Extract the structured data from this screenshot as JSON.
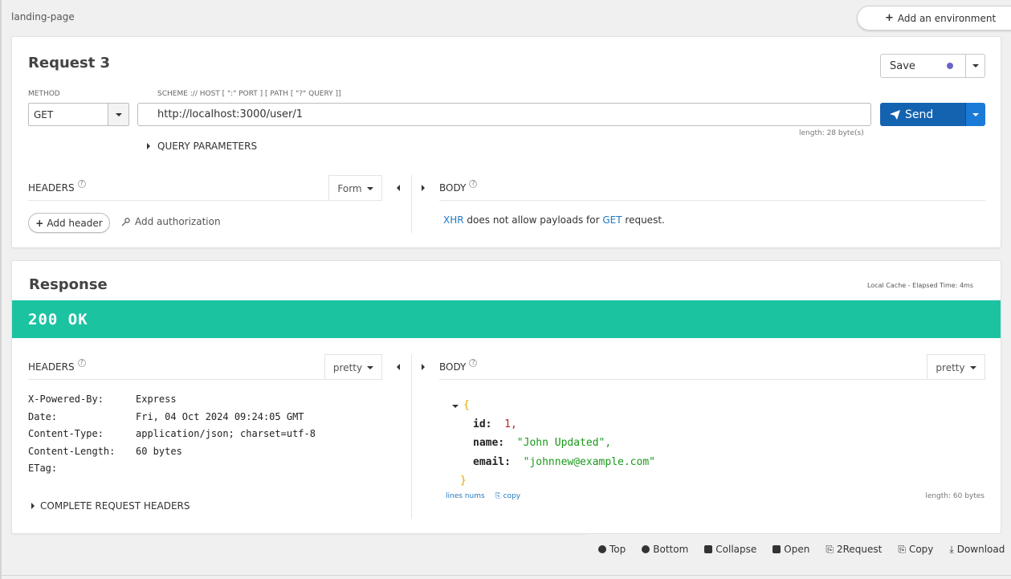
{
  "topbar": {
    "breadcrumb": "landing-page",
    "add_env_label": "Add an environment"
  },
  "request": {
    "title": "Request 3",
    "method_label": "METHOD",
    "url_label": "SCHEME :// HOST [ \":\" PORT ] [ PATH [ \"?\" QUERY ]]",
    "method_value": "GET",
    "url_value": "http://localhost:3000/user/1",
    "url_length": "length: 28 byte(s)",
    "save_label": "Save",
    "send_label": "Send",
    "query_params_label": "QUERY PARAMETERS",
    "headers_label": "HEADERS",
    "headers_mode": "Form",
    "body_label": "BODY",
    "add_header_label": "Add header",
    "add_auth_label": "Add authorization",
    "body_msg_xhr": "XHR",
    "body_msg_mid": " does not allow payloads for ",
    "body_msg_get": "GET",
    "body_msg_end": " request."
  },
  "response": {
    "title": "Response",
    "cache_info": "Local Cache - Elapsed Time: 4ms",
    "status": "200 OK",
    "headers_label": "HEADERS",
    "headers_mode": "pretty",
    "body_label": "BODY",
    "body_mode": "pretty",
    "headers": [
      {
        "key": "X-Powered-By:",
        "value": "Express"
      },
      {
        "key": "Date:",
        "value": "Fri, 04 Oct 2024 09:24:05 GMT"
      },
      {
        "key": "Content-Type:",
        "value": "application/json; charset=utf-8"
      },
      {
        "key": "Content-Length:",
        "value": "60 bytes"
      },
      {
        "key": "ETag:",
        "value": ""
      }
    ],
    "complete_headers_label": "COMPLETE REQUEST HEADERS",
    "json": {
      "open": "{",
      "close": "}",
      "id_key": "id:",
      "id_val": "1,",
      "name_key": "name:",
      "name_val": "\"John Updated\",",
      "email_key": "email:",
      "email_val": "\"johnnew@example.com\""
    },
    "lines_nums_label": "lines nums",
    "copy_label": "copy",
    "body_length": "length: 60 bytes"
  },
  "bottom_bar": {
    "top": "Top",
    "bottom": "Bottom",
    "collapse": "Collapse",
    "open": "Open",
    "to_request": "2Request",
    "copy": "Copy",
    "download": "Download"
  },
  "colors": {
    "status_ok": "#1bc3a1",
    "send_button": "#1463b1",
    "save_dot": "#6a63c9",
    "link": "#1f78c2"
  }
}
